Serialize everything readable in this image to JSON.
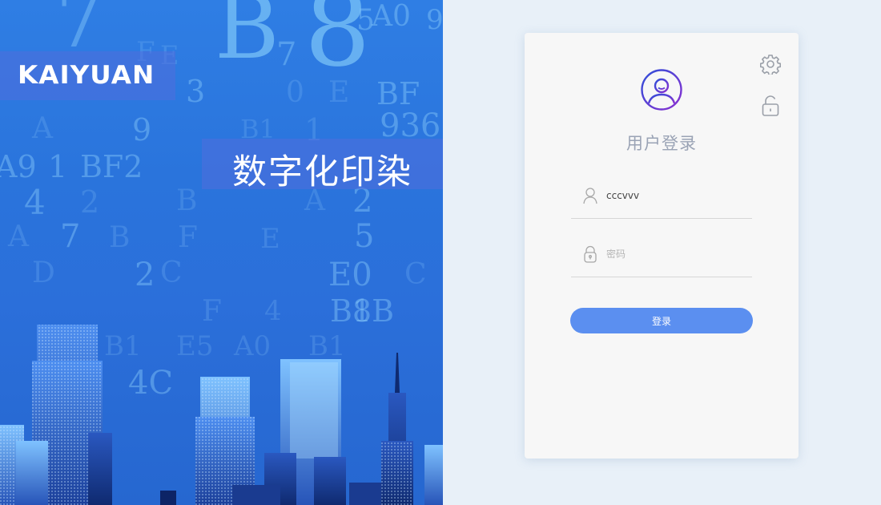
{
  "hero": {
    "logo": "KAIYUAN",
    "title": "数字化印染",
    "background_glyphs": [
      "7",
      "5",
      "B",
      "8",
      "3",
      "4",
      "9",
      "2",
      "6",
      "E",
      "F",
      "C",
      "A",
      "0",
      "1",
      "D",
      "BF",
      "A9",
      "BF2",
      "936",
      "4C",
      "B1",
      "E0",
      "A0",
      "B8",
      "E5",
      "1B"
    ]
  },
  "login": {
    "title": "用户登录",
    "username": {
      "value": "cccvvv",
      "placeholder": ""
    },
    "password": {
      "value": "",
      "placeholder": "密码"
    },
    "submit_label": "登录"
  },
  "icons": {
    "settings": "gear-icon",
    "lock": "unlock-icon",
    "avatar": "user-avatar-icon",
    "user_field": "user-icon",
    "password_field": "lock-icon"
  },
  "colors": {
    "page_background": "#e8f0f8",
    "hero_blue": "#2b6fda",
    "card_background": "#f7f7f7",
    "accent_purple": "#6a35d8",
    "button_blue": "#5b8ff0",
    "muted_text": "#9aa3b5"
  }
}
